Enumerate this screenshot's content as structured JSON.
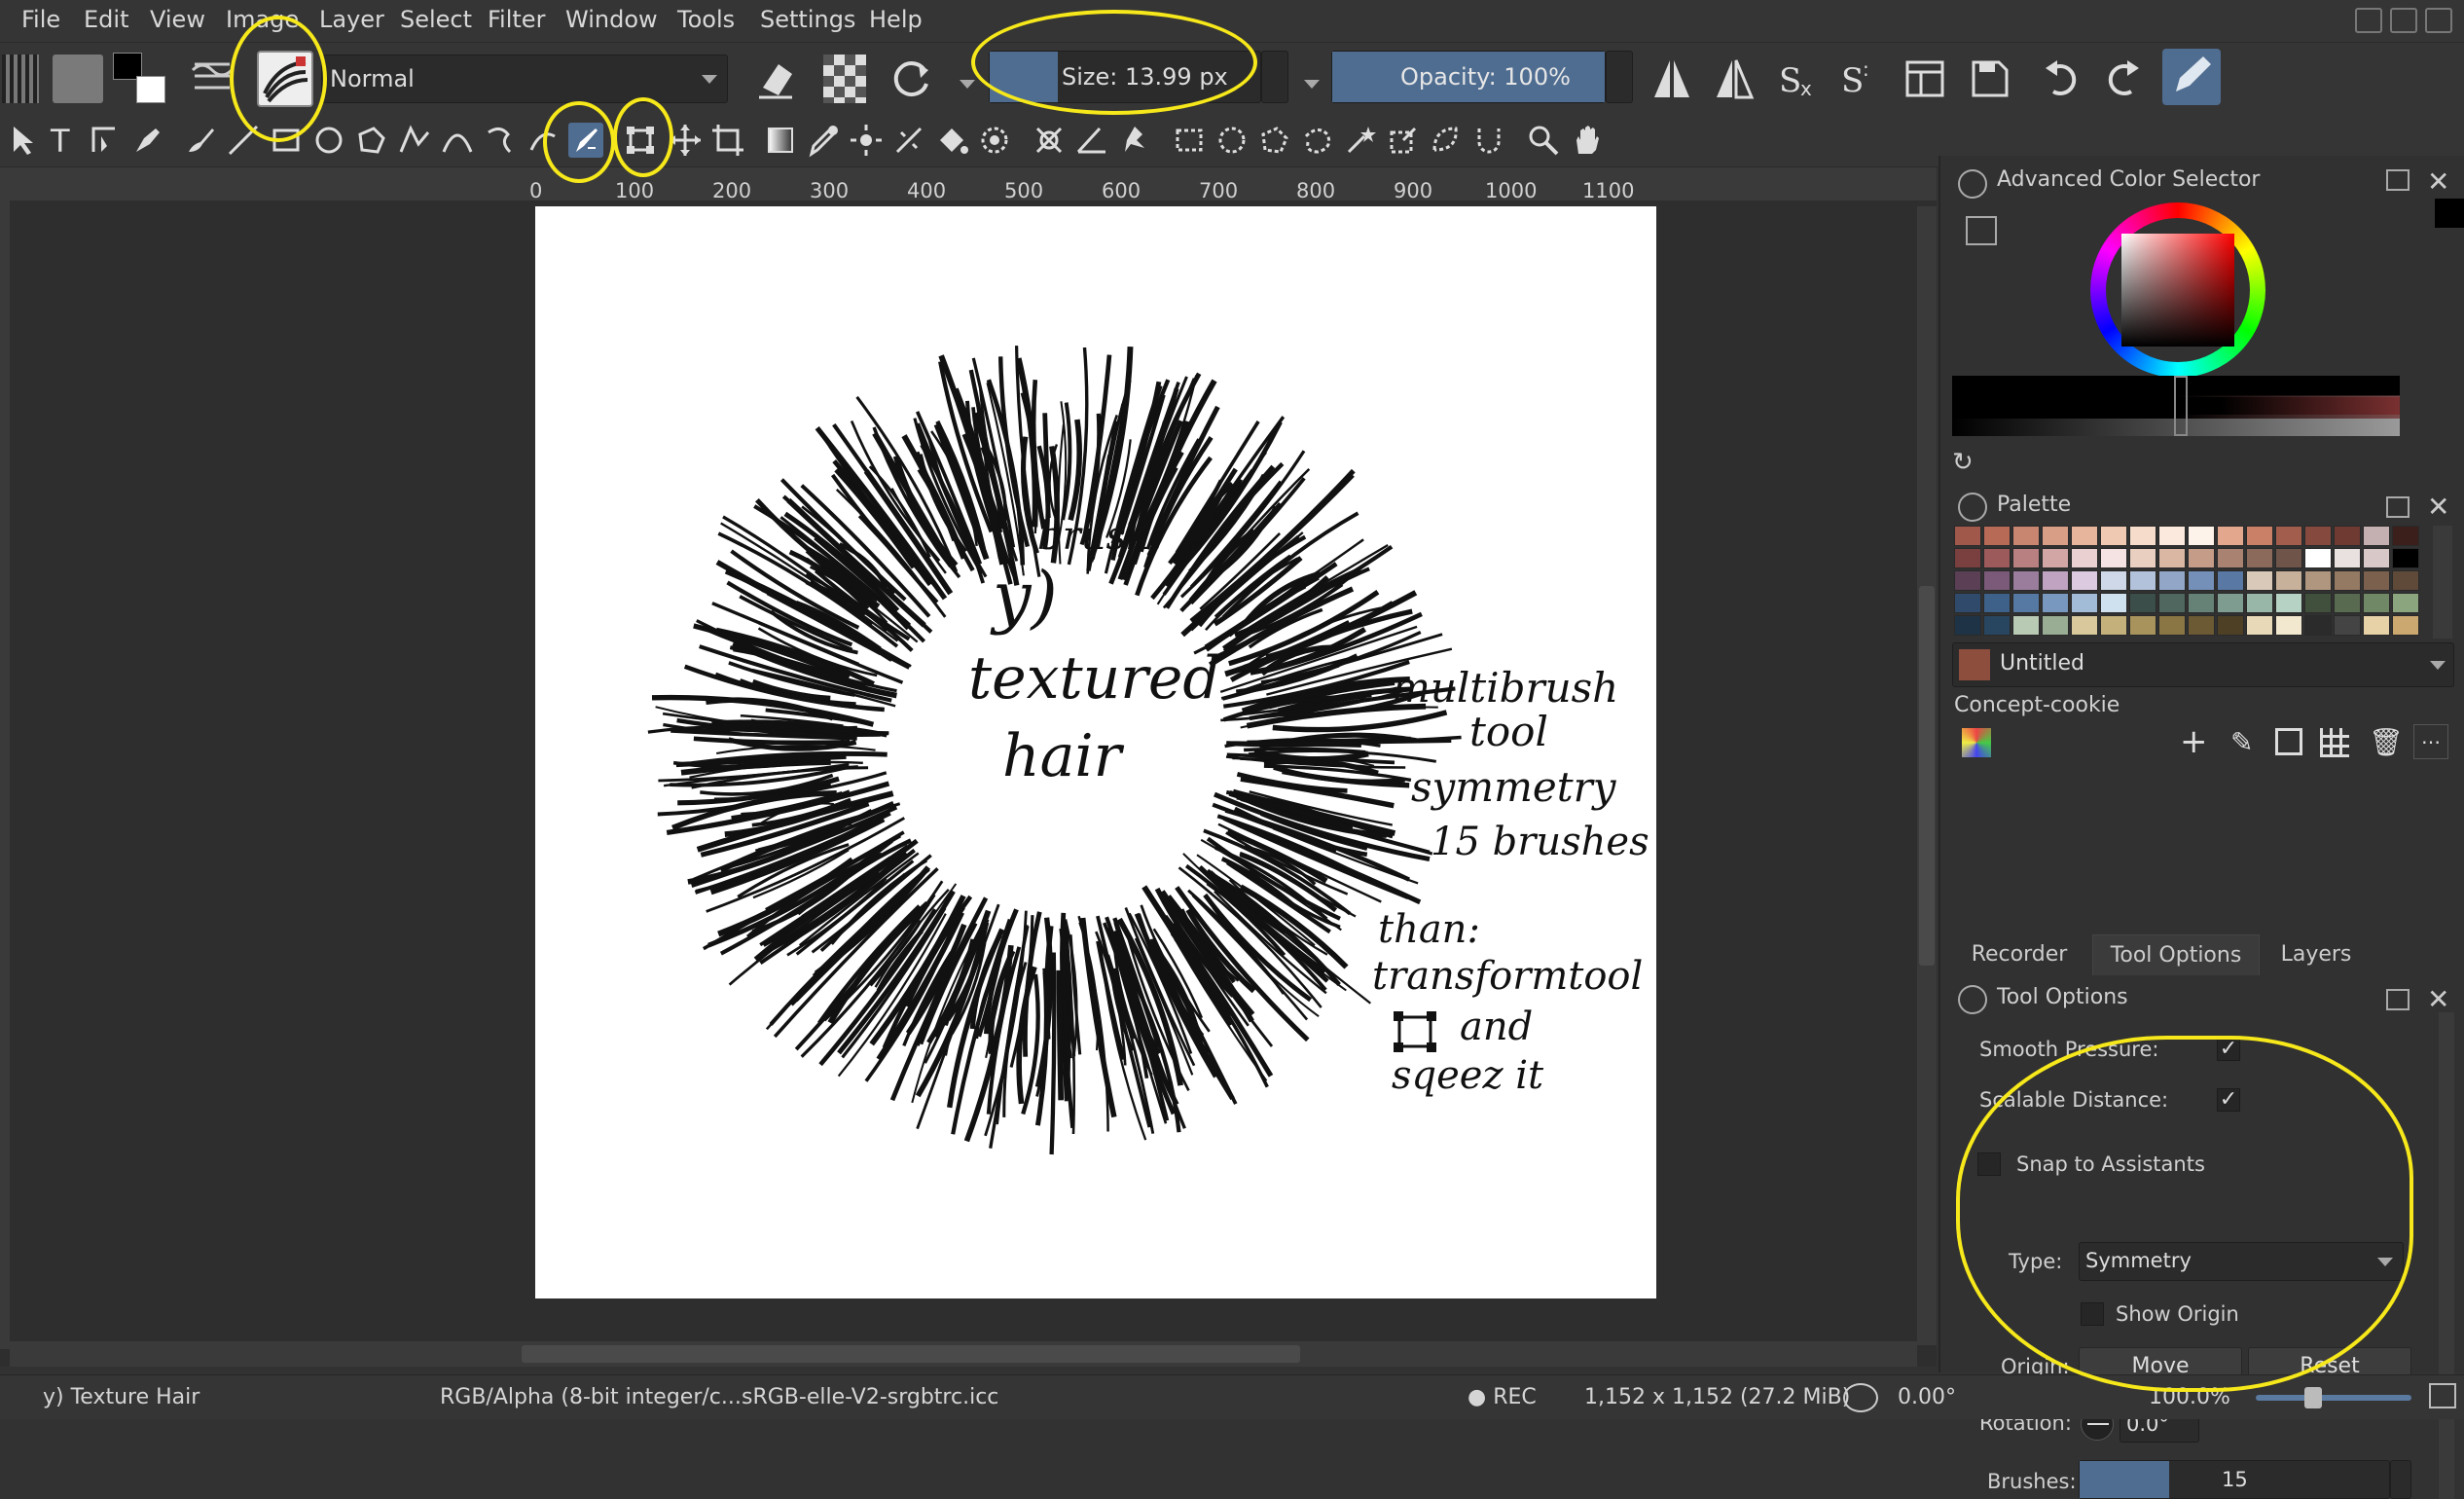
{
  "menu": [
    "File",
    "Edit",
    "View",
    "Image",
    "Layer",
    "Select",
    "Filter",
    "Window",
    "Tools",
    "Settings",
    "Help"
  ],
  "toolbar": {
    "blend_mode": "Normal",
    "size_label": "Size: 13.99 px",
    "opacity_label": "Opacity: 100%"
  },
  "ruler": [
    "0",
    "100",
    "200",
    "300",
    "400",
    "500",
    "600",
    "700",
    "800",
    "900",
    "1000",
    "1100"
  ],
  "canvas_text": {
    "center": [
      "brush:",
      "y)",
      "textured",
      "hair"
    ],
    "side": [
      "multibrush",
      "tool",
      "symmetry",
      "15 brushes",
      "than:",
      "transformtool",
      "and",
      "sqeez it"
    ]
  },
  "color_selector": {
    "title": "Advanced Color Selector"
  },
  "palette": {
    "title": "Palette",
    "name": "Untitled",
    "set_name": "Concept-cookie",
    "swatches": [
      [
        "#a0584a",
        "#b76a56",
        "#c88570",
        "#d99e86",
        "#e7b59c",
        "#f0c9b3",
        "#f6dccb",
        "#fbe9dd",
        "#fdf3ea",
        "#e2a78d",
        "#c98067",
        "#a35d4d",
        "#86493d",
        "#6f3a32",
        "#c4b0b0",
        "#3a1f1a"
      ],
      [
        "#7a3f3f",
        "#9c5a5a",
        "#b88080",
        "#d3a6a6",
        "#ead0d0",
        "#f5e3e3",
        "#e8cfc0",
        "#d9b7a3",
        "#c49c87",
        "#a98271",
        "#8b6a5c",
        "#6e5449",
        "#ffffff",
        "#e9e0e0",
        "#d8c8c8",
        "#000000"
      ],
      [
        "#5a3f55",
        "#7a5a78",
        "#9a7c9c",
        "#bfa3c0",
        "#dccbe0",
        "#cfd8e8",
        "#b2c2da",
        "#92a7c8",
        "#7590b8",
        "#5978a3",
        "#d9c9b9",
        "#c8b19a",
        "#b0967e",
        "#947963",
        "#7a604d",
        "#5f4939"
      ],
      [
        "#2f4a6a",
        "#3e6189",
        "#5679a3",
        "#7898bf",
        "#a2bcd8",
        "#cfe0ee",
        "#3c4e4a",
        "#4f675f",
        "#668277",
        "#7e9c90",
        "#98b7a9",
        "#b6d2c5",
        "#41503c",
        "#586b50",
        "#718867",
        "#8ba57f"
      ],
      [
        "#1e3346",
        "#284660",
        "#b8c9b4",
        "#98ad93",
        "#d8c89c",
        "#c4b07a",
        "#a8935c",
        "#8a7644",
        "#6b5a33",
        "#4d4025",
        "#e8d9b8",
        "#f2e8cf",
        "#2b2b2b",
        "#444444",
        "#e7d2a8",
        "#caa86f"
      ]
    ],
    "current_color": "#8d4e3e"
  },
  "tabs": [
    "Recorder",
    "Tool Options",
    "Layers"
  ],
  "tool_options": {
    "title": "Tool Options",
    "smooth_pressure": "Smooth Pressure:",
    "scalable_distance": "Scalable Distance:",
    "snap": "Snap to Assistants",
    "type_label": "Type:",
    "type_value": "Symmetry",
    "show_origin": "Show Origin",
    "origin_label": "Origin:",
    "move": "Move",
    "reset": "Reset",
    "rotation_label": "Rotation:",
    "rotation_value": "0.0°",
    "brushes_label": "Brushes:",
    "brushes_value": "15"
  },
  "status": {
    "layer": "y) Texture Hair",
    "colorspace": "RGB/Alpha (8-bit integer/c...",
    "profile": "sRGB-elle-V2-srgbtrc.icc",
    "rec": "● REC",
    "dims": "1,152 x 1,152 (27.2 MiB)",
    "angle": "0.00°",
    "zoom": "100.0%"
  },
  "colors": {
    "accent": "#4f6d91",
    "highlight": "#f6e81a"
  }
}
